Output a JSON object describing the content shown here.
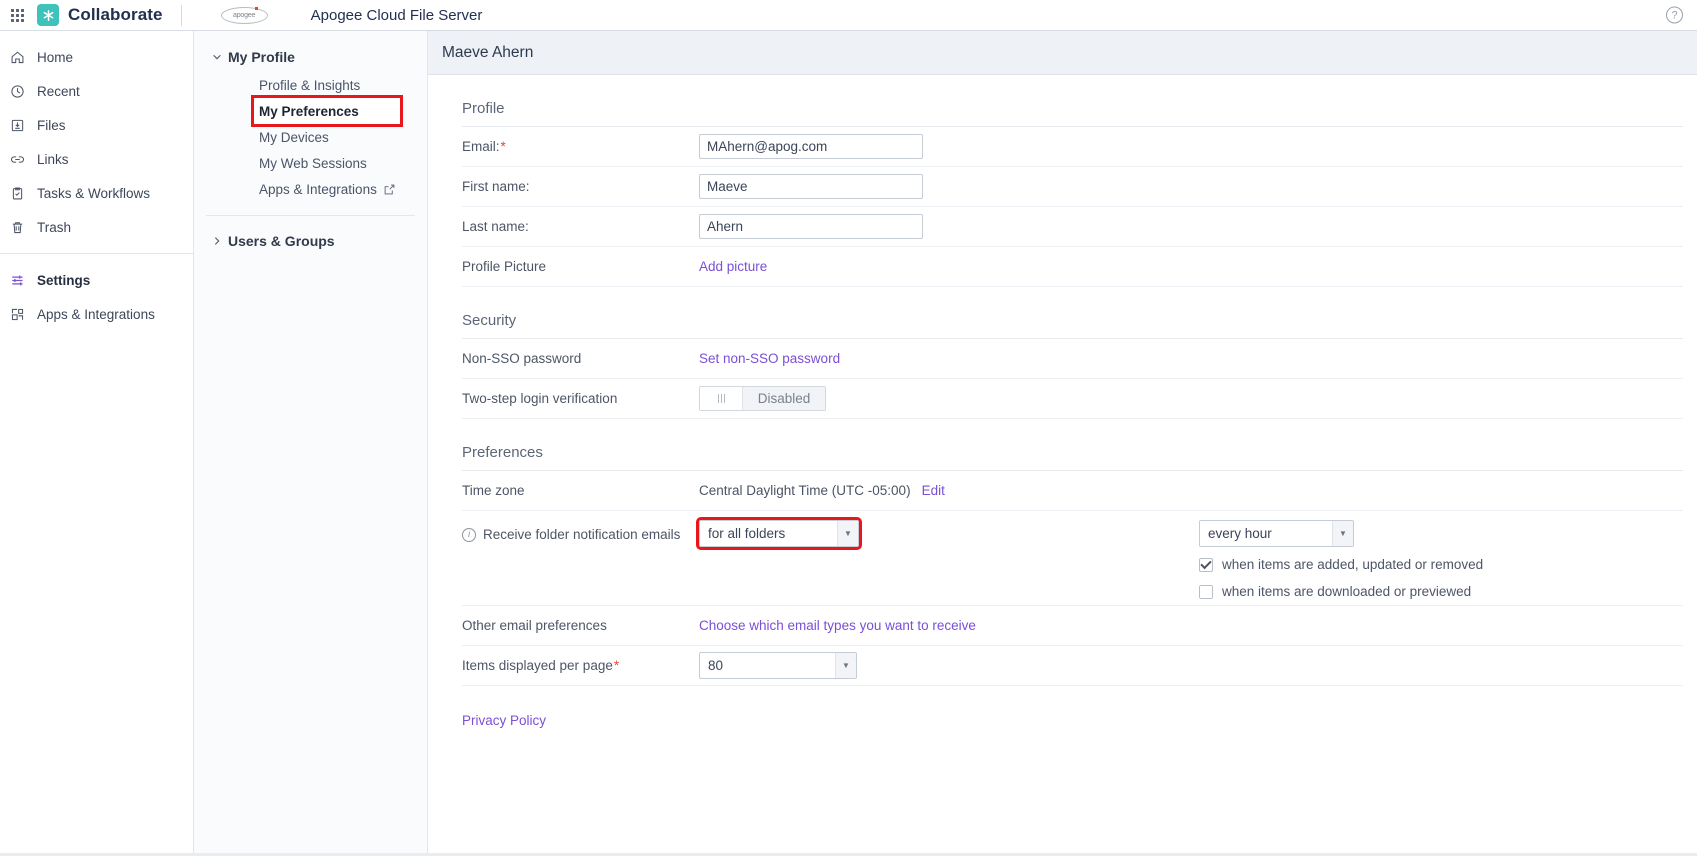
{
  "topbar": {
    "apps_grid_icon": "apps-grid-icon",
    "brand_logo_icon": "collaborate-logo-icon",
    "brand_name": "Collaborate",
    "apogee_logo_text": "apogee",
    "server_title": "Apogee Cloud File Server",
    "help_icon": "help-circle-icon",
    "help_glyph": "?"
  },
  "sidebar": {
    "items": [
      {
        "label": "Home",
        "icon": "home-icon",
        "active": false
      },
      {
        "label": "Recent",
        "icon": "clock-icon",
        "active": false
      },
      {
        "label": "Files",
        "icon": "files-icon",
        "active": false
      },
      {
        "label": "Links",
        "icon": "link-icon",
        "active": false
      },
      {
        "label": "Tasks & Workflows",
        "icon": "clipboard-check-icon",
        "active": false
      },
      {
        "label": "Trash",
        "icon": "trash-icon",
        "active": false
      }
    ],
    "bottom_items": [
      {
        "label": "Settings",
        "icon": "sliders-icon",
        "active": true
      },
      {
        "label": "Apps & Integrations",
        "icon": "apps-blocks-icon",
        "active": false
      }
    ]
  },
  "subnav": {
    "group_my_profile": "My Profile",
    "items": [
      {
        "label": "Profile & Insights",
        "selected": false,
        "external": false
      },
      {
        "label": "My Preferences",
        "selected": true,
        "external": false
      },
      {
        "label": "My Devices",
        "selected": false,
        "external": false
      },
      {
        "label": "My Web Sessions",
        "selected": false,
        "external": false
      },
      {
        "label": "Apps & Integrations",
        "selected": false,
        "external": true
      }
    ],
    "group_users_groups": "Users & Groups",
    "expand_icon": "chevron-down-icon",
    "collapse_icon": "chevron-right-icon",
    "external_icon": "external-link-icon"
  },
  "page": {
    "title": "Maeve Ahern"
  },
  "profile": {
    "section_title": "Profile",
    "email_label": "Email:",
    "email_value": "MAhern@apog.com",
    "first_name_label": "First name:",
    "first_name_value": "Maeve",
    "last_name_label": "Last name:",
    "last_name_value": "Ahern",
    "profile_picture_label": "Profile Picture",
    "add_picture_link": "Add picture",
    "required_marker": "*"
  },
  "security": {
    "section_title": "Security",
    "non_sso_label": "Non-SSO password",
    "non_sso_link": "Set non-SSO password",
    "two_step_label": "Two-step login verification",
    "two_step_state": "Disabled"
  },
  "preferences": {
    "section_title": "Preferences",
    "time_zone_label": "Time zone",
    "time_zone_value": "Central Daylight Time (UTC -05:00)",
    "time_zone_edit": "Edit",
    "notification_label": "Receive folder notification emails",
    "notification_info_icon": "info-icon",
    "notification_scope_value": "for all folders",
    "notification_frequency_value": "every hour",
    "checkbox_added_label": "when items are added, updated or removed",
    "checkbox_added_checked": true,
    "checkbox_downloaded_label": "when items are downloaded or previewed",
    "checkbox_downloaded_checked": false,
    "other_email_label": "Other email preferences",
    "other_email_link": "Choose which email types you want to receive",
    "items_per_page_label": "Items displayed per page",
    "items_per_page_value": "80",
    "required_marker": "*"
  },
  "footer": {
    "privacy_policy": "Privacy Policy"
  },
  "colors": {
    "brand_teal": "#3ec2bb",
    "accent_purple": "#7b4fd6",
    "highlight_red": "#e8171b",
    "required_red": "#e8453c",
    "header_band": "#eef1f6"
  }
}
